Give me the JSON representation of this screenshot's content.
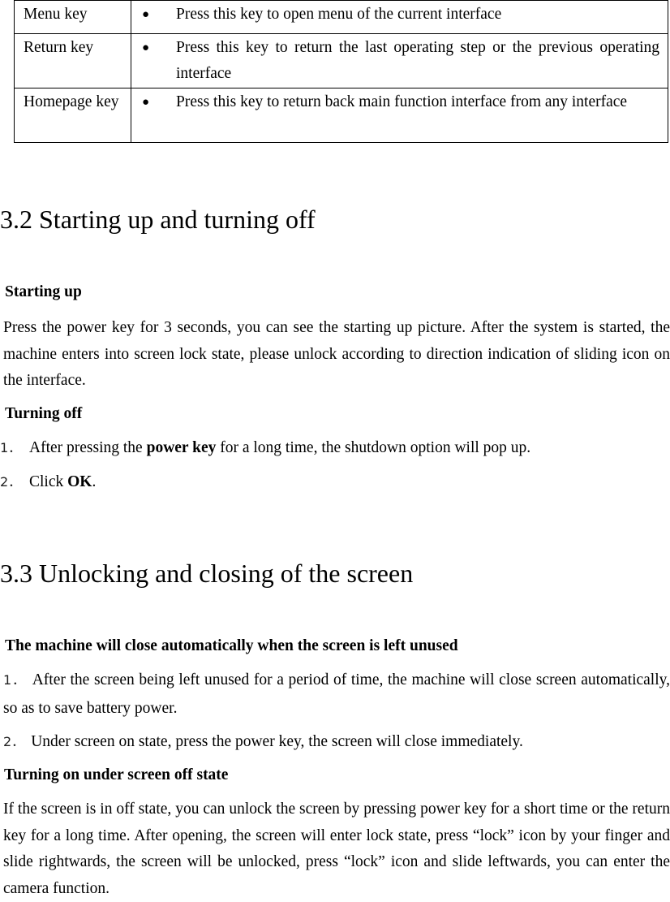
{
  "key_table": {
    "bullet_glyph": "●",
    "rows": [
      {
        "key": "Menu key",
        "description": "Press this key to open menu of the current interface"
      },
      {
        "key": "Return key",
        "description": "Press this key to return the last operating step or the previous operating interface"
      },
      {
        "key": "Homepage key",
        "description": "Press this key to return back main function interface from any interface"
      }
    ]
  },
  "section_3_2": {
    "title": "3.2 Starting up and turning off",
    "starting_up": {
      "heading": "Starting up",
      "body": "Press the power key for 3 seconds, you can see the starting up picture. After the system is started, the machine enters into screen lock state, please unlock according to direction indication of sliding icon on the interface."
    },
    "turning_off": {
      "heading": "Turning off",
      "steps": [
        {
          "num": "1．",
          "pre": "After pressing the ",
          "bold": "power key",
          "post": " for a long time, the shutdown option will pop up."
        },
        {
          "num": "2．",
          "pre": "Click ",
          "bold": "OK",
          "post": "."
        }
      ]
    }
  },
  "section_3_3": {
    "title": "3.3 Unlocking and closing of the screen",
    "auto_close": {
      "heading": "The machine will close automatically when the screen is left unused",
      "items": [
        {
          "num": "1．",
          "text": "After the screen being left unused for a period of time, the machine will close screen automatically, so as to save battery power."
        },
        {
          "num": "2．",
          "text": "Under screen on state, press the power key, the screen will close immediately."
        }
      ]
    },
    "turning_on": {
      "heading": "Turning on under screen off state",
      "body": "If the screen is in off state, you can unlock the screen by pressing power key for a short time or the return key for a long time. After opening, the screen will enter lock state, press “lock” icon by your finger and slide rightwards, the screen will be unlocked, press “lock” icon and slide leftwards, you can enter the camera function."
    }
  }
}
